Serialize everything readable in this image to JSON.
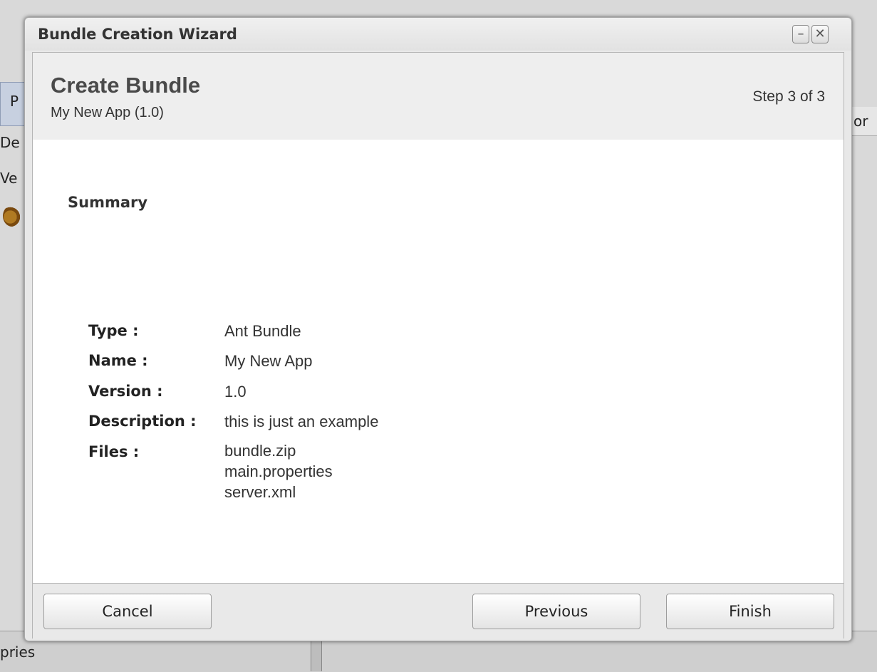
{
  "background_app": {
    "fragments": [
      "P",
      "De",
      "Ve",
      "or",
      "pries"
    ]
  },
  "dialog": {
    "title": "Bundle Creation Wizard",
    "minimize_glyph": "–",
    "close_glyph": "✕"
  },
  "wizard": {
    "title": "Create Bundle",
    "subtitle": "My New App (1.0)",
    "step": "Step 3 of 3"
  },
  "summary": {
    "heading": "Summary",
    "type_label": "Type :",
    "type_value": "Ant Bundle",
    "name_label": "Name :",
    "name_value": "My New App",
    "version_label": "Version :",
    "version_value": "1.0",
    "description_label": "Description :",
    "description_value": "this is just an example",
    "files_label": "Files :",
    "files": [
      "bundle.zip",
      "main.properties",
      "server.xml"
    ]
  },
  "buttons": {
    "cancel": "Cancel",
    "previous": "Previous",
    "finish": "Finish"
  }
}
